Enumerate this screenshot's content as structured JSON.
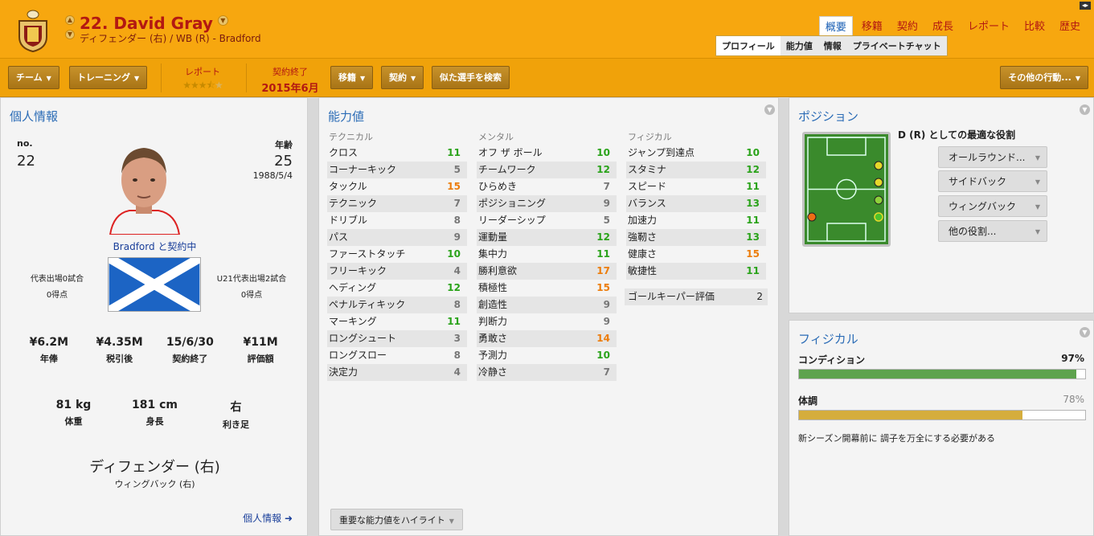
{
  "header": {
    "title": "22. David Gray",
    "subtitle": "ディフェンダー (右) / WB (R) - Bradford",
    "nav_tabs": [
      "概要",
      "移籍",
      "契約",
      "成長",
      "レポート",
      "比較",
      "歴史"
    ],
    "sub_tabs": [
      "プロフィール",
      "能力値",
      "情報",
      "プライベートチャット"
    ]
  },
  "toolbar": {
    "team": "チーム",
    "training": "トレーニング",
    "report_label": "レポート",
    "report_stars": 3.5,
    "contract_label": "契約終了",
    "contract_value": "2015年6月",
    "transfer": "移籍",
    "contract": "契約",
    "similar": "似た選手を検索",
    "other_actions": "その他の行動..."
  },
  "personal": {
    "title": "個人情報",
    "no_label": "no.",
    "no_value": "22",
    "age_label": "年齢",
    "age_value": "25",
    "dob": "1988/5/4",
    "club_contract": "Bradford と契約中",
    "intl_caps": "代表出場0試合",
    "intl_goals": "0得点",
    "u21_caps": "U21代表出場2試合",
    "u21_goals": "0得点",
    "finances": [
      {
        "value": "¥6.2M",
        "label": "年俸"
      },
      {
        "value": "¥4.35M",
        "label": "税引後"
      },
      {
        "value": "15/6/30",
        "label": "契約終了"
      },
      {
        "value": "¥11M",
        "label": "評価額"
      }
    ],
    "physical": [
      {
        "value": "81 kg",
        "label": "体重"
      },
      {
        "value": "181 cm",
        "label": "身長"
      },
      {
        "value": "右",
        "label": "利き足"
      }
    ],
    "position_main": "ディフェンダー (右)",
    "position_sub": "ウィングバック (右)",
    "more_info": "個人情報"
  },
  "attributes": {
    "title": "能力値",
    "technical": {
      "title": "テクニカル",
      "rows": [
        {
          "name": "クロス",
          "value": "11"
        },
        {
          "name": "コーナーキック",
          "value": "5"
        },
        {
          "name": "タックル",
          "value": "15"
        },
        {
          "name": "テクニック",
          "value": "7"
        },
        {
          "name": "ドリブル",
          "value": "8"
        },
        {
          "name": "パス",
          "value": "9"
        },
        {
          "name": "ファーストタッチ",
          "value": "10"
        },
        {
          "name": "フリーキック",
          "value": "4"
        },
        {
          "name": "ヘディング",
          "value": "12"
        },
        {
          "name": "ペナルティキック",
          "value": "8"
        },
        {
          "name": "マーキング",
          "value": "11"
        },
        {
          "name": "ロングシュート",
          "value": "3"
        },
        {
          "name": "ロングスロー",
          "value": "8"
        },
        {
          "name": "決定力",
          "value": "4"
        }
      ]
    },
    "mental": {
      "title": "メンタル",
      "rows": [
        {
          "name": "オフ ザ ボール",
          "value": "10"
        },
        {
          "name": "チームワーク",
          "value": "12"
        },
        {
          "name": "ひらめき",
          "value": "7"
        },
        {
          "name": "ポジショニング",
          "value": "9"
        },
        {
          "name": "リーダーシップ",
          "value": "5"
        },
        {
          "name": "運動量",
          "value": "12"
        },
        {
          "name": "集中力",
          "value": "11"
        },
        {
          "name": "勝利意欲",
          "value": "17"
        },
        {
          "name": "積極性",
          "value": "15"
        },
        {
          "name": "創造性",
          "value": "9"
        },
        {
          "name": "判断力",
          "value": "9"
        },
        {
          "name": "勇敢さ",
          "value": "14"
        },
        {
          "name": "予測力",
          "value": "10"
        },
        {
          "name": "冷静さ",
          "value": "7"
        }
      ]
    },
    "physical": {
      "title": "フィジカル",
      "rows": [
        {
          "name": "ジャンプ到達点",
          "value": "10"
        },
        {
          "name": "スタミナ",
          "value": "12"
        },
        {
          "name": "スピード",
          "value": "11"
        },
        {
          "name": "バランス",
          "value": "13"
        },
        {
          "name": "加速力",
          "value": "11"
        },
        {
          "name": "強靭さ",
          "value": "13"
        },
        {
          "name": "健康さ",
          "value": "15"
        },
        {
          "name": "敏捷性",
          "value": "11"
        }
      ]
    },
    "gk_label": "ゴールキーパー評価",
    "gk_value": "2",
    "highlight_btn": "重要な能力値をハイライト"
  },
  "position": {
    "title": "ポジション",
    "role_title": "D (R) としての最適な役割",
    "roles": [
      "オールラウンド...",
      "サイドバック",
      "ウィングバック",
      "他の役割..."
    ]
  },
  "fisico": {
    "title": "フィジカル",
    "condition_label": "コンディション",
    "condition_value": "97%",
    "condition_fraction": 0.97,
    "fitness_label": "体調",
    "fitness_value": "78%",
    "fitness_fraction": 0.78,
    "note": "新シーズン開幕前に 調子を万全にする必要がある"
  },
  "colors": {
    "accent": "#f7a70f",
    "title_red": "#b31812",
    "link_blue": "#2b6cb6",
    "good": "#2aa31a",
    "high": "#ec7d0c",
    "condition_bar": "#5ea34e",
    "fitness_bar": "#d5ad3c"
  }
}
